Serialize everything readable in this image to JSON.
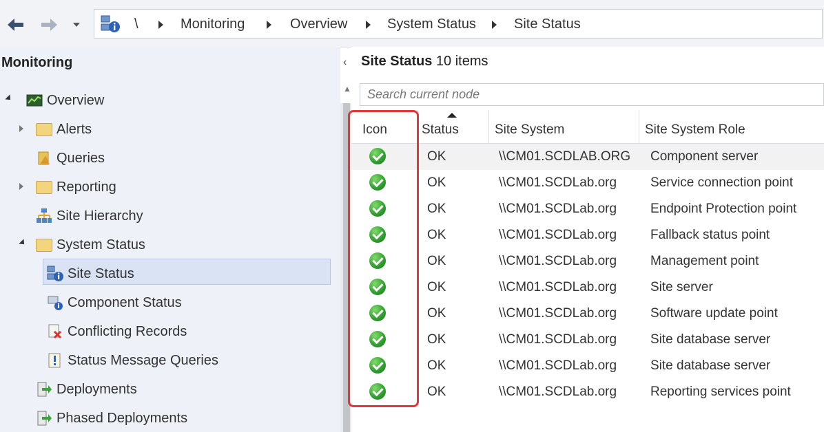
{
  "address_bar": {
    "root_symbol": "\\",
    "crumbs": [
      "Monitoring",
      "Overview",
      "System Status",
      "Site Status"
    ]
  },
  "left_pane": {
    "title": "Monitoring",
    "tree": {
      "overview": "Overview",
      "alerts": "Alerts",
      "queries": "Queries",
      "reporting": "Reporting",
      "site_hierarchy": "Site Hierarchy",
      "system_status": "System Status",
      "site_status": "Site Status",
      "component_status": "Component Status",
      "conflicting_records": "Conflicting Records",
      "status_message_queries": "Status Message Queries",
      "deployments": "Deployments",
      "phased_deployments": "Phased Deployments"
    }
  },
  "right_pane": {
    "title": "Site Status",
    "count": "10 items",
    "search_placeholder": "Search current node",
    "columns": [
      "Icon",
      "Status",
      "Site System",
      "Site System Role"
    ],
    "rows": [
      {
        "status": "OK",
        "system": "\\\\CM01.SCDLAB.ORG",
        "role": "Component server"
      },
      {
        "status": "OK",
        "system": "\\\\CM01.SCDLab.org",
        "role": "Service connection point"
      },
      {
        "status": "OK",
        "system": "\\\\CM01.SCDLab.org",
        "role": "Endpoint Protection point"
      },
      {
        "status": "OK",
        "system": "\\\\CM01.SCDLab.org",
        "role": "Fallback status point"
      },
      {
        "status": "OK",
        "system": "\\\\CM01.SCDLab.org",
        "role": "Management point"
      },
      {
        "status": "OK",
        "system": "\\\\CM01.SCDLab.org",
        "role": "Site server"
      },
      {
        "status": "OK",
        "system": "\\\\CM01.SCDLab.org",
        "role": "Software update point"
      },
      {
        "status": "OK",
        "system": "\\\\CM01.SCDLab.org",
        "role": "Site database server"
      },
      {
        "status": "OK",
        "system": "\\\\CM01.SCDLab.org",
        "role": "Site database server"
      },
      {
        "status": "OK",
        "system": "\\\\CM01.SCDLab.org",
        "role": "Reporting services point"
      }
    ]
  },
  "colors": {
    "highlight": "#e0383a",
    "ok_green": "#2f9b2f",
    "left_pane_bg": "#eef1f7",
    "selection": "#d9e3f3"
  },
  "icons": [
    "back-arrow-icon",
    "forward-arrow-icon",
    "dropdown-icon",
    "site-status-icon",
    "overview-icon",
    "folder-icon",
    "queries-icon",
    "site-hierarchy-icon",
    "component-status-icon",
    "conflicting-records-icon",
    "status-message-icon",
    "deployments-icon",
    "ok-status-icon"
  ]
}
